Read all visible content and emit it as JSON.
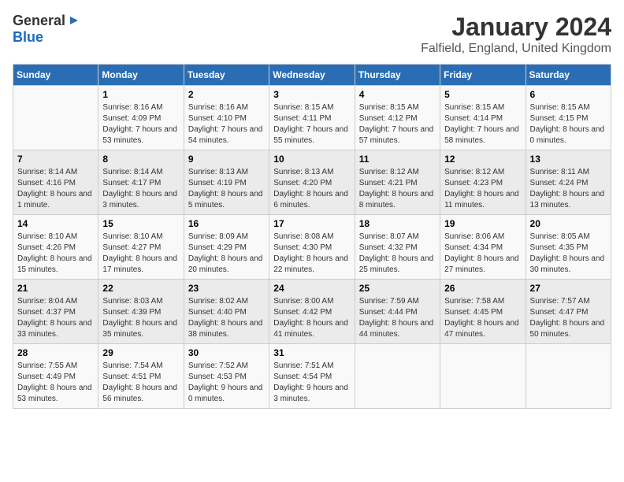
{
  "logo": {
    "general": "General",
    "blue": "Blue"
  },
  "title": "January 2024",
  "location": "Falfield, England, United Kingdom",
  "days_of_week": [
    "Sunday",
    "Monday",
    "Tuesday",
    "Wednesday",
    "Thursday",
    "Friday",
    "Saturday"
  ],
  "weeks": [
    [
      {
        "day": "",
        "sunrise": "",
        "sunset": "",
        "daylight": ""
      },
      {
        "day": "1",
        "sunrise": "Sunrise: 8:16 AM",
        "sunset": "Sunset: 4:09 PM",
        "daylight": "Daylight: 7 hours and 53 minutes."
      },
      {
        "day": "2",
        "sunrise": "Sunrise: 8:16 AM",
        "sunset": "Sunset: 4:10 PM",
        "daylight": "Daylight: 7 hours and 54 minutes."
      },
      {
        "day": "3",
        "sunrise": "Sunrise: 8:15 AM",
        "sunset": "Sunset: 4:11 PM",
        "daylight": "Daylight: 7 hours and 55 minutes."
      },
      {
        "day": "4",
        "sunrise": "Sunrise: 8:15 AM",
        "sunset": "Sunset: 4:12 PM",
        "daylight": "Daylight: 7 hours and 57 minutes."
      },
      {
        "day": "5",
        "sunrise": "Sunrise: 8:15 AM",
        "sunset": "Sunset: 4:14 PM",
        "daylight": "Daylight: 7 hours and 58 minutes."
      },
      {
        "day": "6",
        "sunrise": "Sunrise: 8:15 AM",
        "sunset": "Sunset: 4:15 PM",
        "daylight": "Daylight: 8 hours and 0 minutes."
      }
    ],
    [
      {
        "day": "7",
        "sunrise": "Sunrise: 8:14 AM",
        "sunset": "Sunset: 4:16 PM",
        "daylight": "Daylight: 8 hours and 1 minute."
      },
      {
        "day": "8",
        "sunrise": "Sunrise: 8:14 AM",
        "sunset": "Sunset: 4:17 PM",
        "daylight": "Daylight: 8 hours and 3 minutes."
      },
      {
        "day": "9",
        "sunrise": "Sunrise: 8:13 AM",
        "sunset": "Sunset: 4:19 PM",
        "daylight": "Daylight: 8 hours and 5 minutes."
      },
      {
        "day": "10",
        "sunrise": "Sunrise: 8:13 AM",
        "sunset": "Sunset: 4:20 PM",
        "daylight": "Daylight: 8 hours and 6 minutes."
      },
      {
        "day": "11",
        "sunrise": "Sunrise: 8:12 AM",
        "sunset": "Sunset: 4:21 PM",
        "daylight": "Daylight: 8 hours and 8 minutes."
      },
      {
        "day": "12",
        "sunrise": "Sunrise: 8:12 AM",
        "sunset": "Sunset: 4:23 PM",
        "daylight": "Daylight: 8 hours and 11 minutes."
      },
      {
        "day": "13",
        "sunrise": "Sunrise: 8:11 AM",
        "sunset": "Sunset: 4:24 PM",
        "daylight": "Daylight: 8 hours and 13 minutes."
      }
    ],
    [
      {
        "day": "14",
        "sunrise": "Sunrise: 8:10 AM",
        "sunset": "Sunset: 4:26 PM",
        "daylight": "Daylight: 8 hours and 15 minutes."
      },
      {
        "day": "15",
        "sunrise": "Sunrise: 8:10 AM",
        "sunset": "Sunset: 4:27 PM",
        "daylight": "Daylight: 8 hours and 17 minutes."
      },
      {
        "day": "16",
        "sunrise": "Sunrise: 8:09 AM",
        "sunset": "Sunset: 4:29 PM",
        "daylight": "Daylight: 8 hours and 20 minutes."
      },
      {
        "day": "17",
        "sunrise": "Sunrise: 8:08 AM",
        "sunset": "Sunset: 4:30 PM",
        "daylight": "Daylight: 8 hours and 22 minutes."
      },
      {
        "day": "18",
        "sunrise": "Sunrise: 8:07 AM",
        "sunset": "Sunset: 4:32 PM",
        "daylight": "Daylight: 8 hours and 25 minutes."
      },
      {
        "day": "19",
        "sunrise": "Sunrise: 8:06 AM",
        "sunset": "Sunset: 4:34 PM",
        "daylight": "Daylight: 8 hours and 27 minutes."
      },
      {
        "day": "20",
        "sunrise": "Sunrise: 8:05 AM",
        "sunset": "Sunset: 4:35 PM",
        "daylight": "Daylight: 8 hours and 30 minutes."
      }
    ],
    [
      {
        "day": "21",
        "sunrise": "Sunrise: 8:04 AM",
        "sunset": "Sunset: 4:37 PM",
        "daylight": "Daylight: 8 hours and 33 minutes."
      },
      {
        "day": "22",
        "sunrise": "Sunrise: 8:03 AM",
        "sunset": "Sunset: 4:39 PM",
        "daylight": "Daylight: 8 hours and 35 minutes."
      },
      {
        "day": "23",
        "sunrise": "Sunrise: 8:02 AM",
        "sunset": "Sunset: 4:40 PM",
        "daylight": "Daylight: 8 hours and 38 minutes."
      },
      {
        "day": "24",
        "sunrise": "Sunrise: 8:00 AM",
        "sunset": "Sunset: 4:42 PM",
        "daylight": "Daylight: 8 hours and 41 minutes."
      },
      {
        "day": "25",
        "sunrise": "Sunrise: 7:59 AM",
        "sunset": "Sunset: 4:44 PM",
        "daylight": "Daylight: 8 hours and 44 minutes."
      },
      {
        "day": "26",
        "sunrise": "Sunrise: 7:58 AM",
        "sunset": "Sunset: 4:45 PM",
        "daylight": "Daylight: 8 hours and 47 minutes."
      },
      {
        "day": "27",
        "sunrise": "Sunrise: 7:57 AM",
        "sunset": "Sunset: 4:47 PM",
        "daylight": "Daylight: 8 hours and 50 minutes."
      }
    ],
    [
      {
        "day": "28",
        "sunrise": "Sunrise: 7:55 AM",
        "sunset": "Sunset: 4:49 PM",
        "daylight": "Daylight: 8 hours and 53 minutes."
      },
      {
        "day": "29",
        "sunrise": "Sunrise: 7:54 AM",
        "sunset": "Sunset: 4:51 PM",
        "daylight": "Daylight: 8 hours and 56 minutes."
      },
      {
        "day": "30",
        "sunrise": "Sunrise: 7:52 AM",
        "sunset": "Sunset: 4:53 PM",
        "daylight": "Daylight: 9 hours and 0 minutes."
      },
      {
        "day": "31",
        "sunrise": "Sunrise: 7:51 AM",
        "sunset": "Sunset: 4:54 PM",
        "daylight": "Daylight: 9 hours and 3 minutes."
      },
      {
        "day": "",
        "sunrise": "",
        "sunset": "",
        "daylight": ""
      },
      {
        "day": "",
        "sunrise": "",
        "sunset": "",
        "daylight": ""
      },
      {
        "day": "",
        "sunrise": "",
        "sunset": "",
        "daylight": ""
      }
    ]
  ]
}
